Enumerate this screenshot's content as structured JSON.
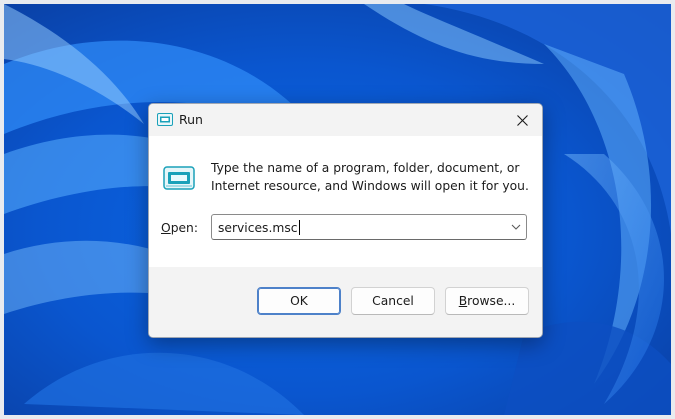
{
  "window": {
    "title": "Run",
    "icon": "run-icon",
    "close_icon": "close-icon"
  },
  "content": {
    "description_line1": "Type the name of a program, folder, document, or",
    "description_line2": "Internet resource, and Windows will open it for you.",
    "open_label_accel": "O",
    "open_label_rest": "pen:",
    "input_value": "services.msc",
    "dropdown_icon": "chevron-down-icon"
  },
  "buttons": {
    "ok": "OK",
    "cancel": "Cancel",
    "browse_accel": "B",
    "browse_rest": "rowse..."
  },
  "colors": {
    "wallpaper_accent": "#0a5bd6",
    "default_button_border": "#4d81c9",
    "icon_accent": "#1aa1b9"
  }
}
